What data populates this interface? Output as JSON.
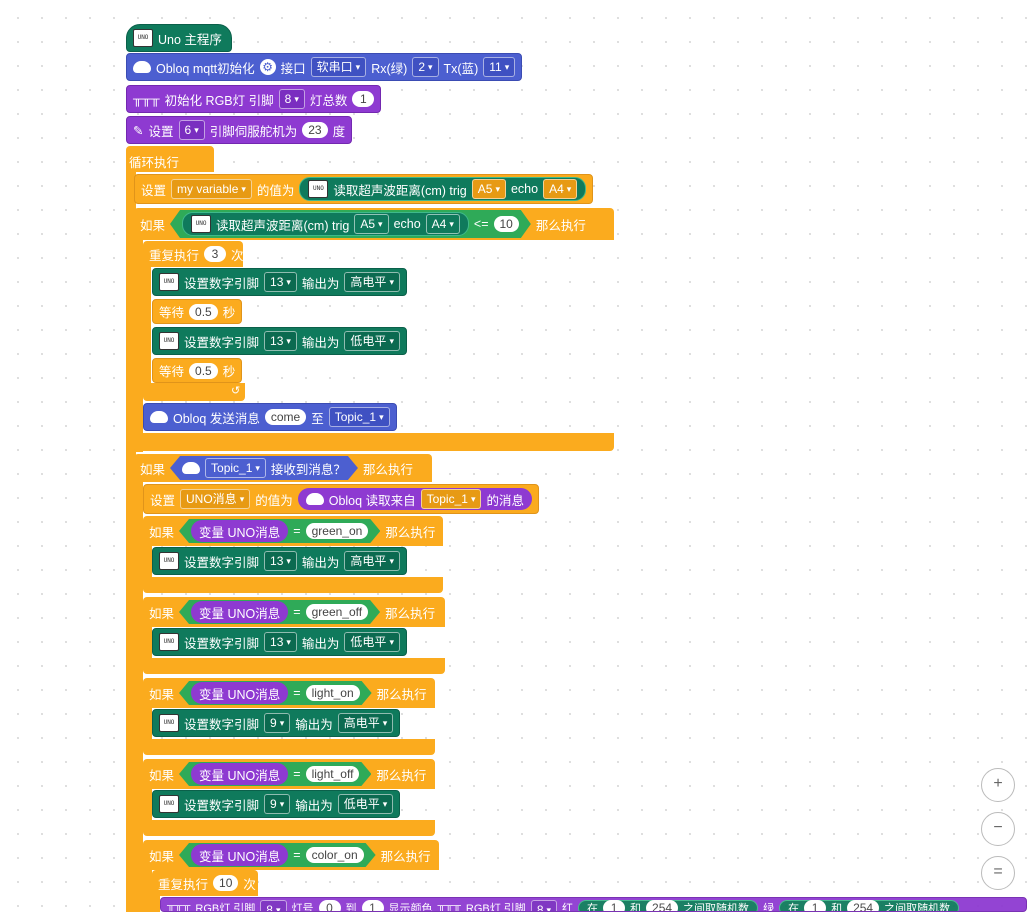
{
  "program": {
    "hat": "Uno 主程序",
    "mqtt": {
      "label": "Obloq mqtt初始化",
      "port_label": "接口",
      "port": "软串口",
      "rx_label": "Rx(绿)",
      "rx": "2",
      "tx_label": "Tx(蓝)",
      "tx": "11"
    },
    "rgb_init": {
      "label": "初始化 RGB灯 引脚",
      "pin": "8",
      "count_label": "灯总数",
      "count": "1"
    },
    "servo": {
      "label": "设置",
      "pin": "6",
      "mid": "引脚伺服舵机为",
      "angle": "23",
      "unit": "度"
    },
    "loop": "循环执行"
  },
  "set_var": {
    "label": "设置",
    "var": "my variable",
    "mid": "的值为",
    "sensor": "读取超声波距离(cm) trig",
    "trig": "A5",
    "echo_label": "echo",
    "echo": "A4"
  },
  "if1": {
    "if": "如果",
    "sensor": "读取超声波距离(cm) trig",
    "trig": "A5",
    "echo_label": "echo",
    "echo": "A4",
    "op": "<=",
    "value": "10",
    "then": "那么执行"
  },
  "repeat1": {
    "label": "重复执行",
    "times": "3",
    "unit": "次"
  },
  "pin_on": {
    "label": "设置数字引脚",
    "pin": "13",
    "out": "输出为",
    "level": "高电平"
  },
  "wait": {
    "label": "等待",
    "value": "0.5",
    "unit": "秒"
  },
  "pin_off": {
    "label": "设置数字引脚",
    "pin": "13",
    "out": "输出为",
    "level": "低电平"
  },
  "send": {
    "label": "Obloq 发送消息",
    "msg": "come",
    "to": "至",
    "topic": "Topic_1"
  },
  "if2": {
    "if": "如果",
    "topic": "Topic_1",
    "recv": "接收到消息？",
    "then": "那么执行"
  },
  "set_uno": {
    "label": "设置",
    "var": "UNO消息",
    "mid": "的值为",
    "read": "Obloq 读取来自",
    "topic": "Topic_1",
    "suffix": "的消息"
  },
  "conds": [
    {
      "if": "如果",
      "var": "变量 UNO消息",
      "eq": "=",
      "val": "green_on",
      "then": "那么执行",
      "pin": "13",
      "out": "输出为",
      "level": "高电平",
      "set": "设置数字引脚"
    },
    {
      "if": "如果",
      "var": "变量 UNO消息",
      "eq": "=",
      "val": "green_off",
      "then": "那么执行",
      "pin": "13",
      "out": "输出为",
      "level": "低电平",
      "set": "设置数字引脚"
    },
    {
      "if": "如果",
      "var": "变量 UNO消息",
      "eq": "=",
      "val": "light_on",
      "then": "那么执行",
      "pin": "9",
      "out": "输出为",
      "level": "高电平",
      "set": "设置数字引脚"
    },
    {
      "if": "如果",
      "var": "变量 UNO消息",
      "eq": "=",
      "val": "light_off",
      "then": "那么执行",
      "pin": "9",
      "out": "输出为",
      "level": "低电平",
      "set": "设置数字引脚"
    },
    {
      "if": "如果",
      "var": "变量 UNO消息",
      "eq": "=",
      "val": "color_on",
      "then": "那么执行"
    }
  ],
  "repeat2": {
    "label": "重复执行",
    "times": "10",
    "unit": "次"
  },
  "rgb_row": {
    "t1": "RGB灯 引脚",
    "pin": "8",
    "t2": "灯号",
    "from": "0",
    "t3": "到",
    "to": "1",
    "t4": "显示颜色",
    "t5": "RGB灯 引脚",
    "pin2": "8",
    "red": "红",
    "in": "在",
    "a": "1",
    "and": "和",
    "b": "254",
    "rand": "之间取随机数",
    "green": "绿",
    "a2": "1",
    "b2": "254"
  },
  "zoom": {
    "in": "+",
    "out": "−",
    "reset": "="
  }
}
